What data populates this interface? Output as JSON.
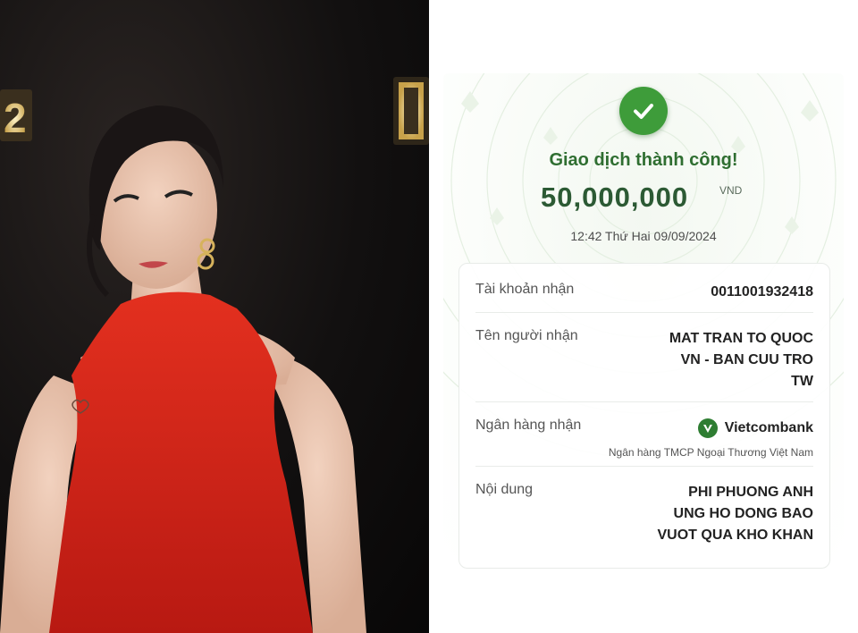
{
  "receipt": {
    "status": "Giao dịch thành công!",
    "amount": "50,000,000",
    "currency": "VND",
    "datetime": "12:42 Thứ Hai 09/09/2024",
    "account_label": "Tài khoản nhận",
    "account_value": "0011001932418",
    "recipient_label": "Tên người nhận",
    "recipient_lines": [
      "MAT TRAN TO QUOC",
      "VN - BAN CUU TRO",
      "TW"
    ],
    "bank_label": "Ngân hàng nhận",
    "bank_name": "Vietcombank",
    "bank_fullname": "Ngân hàng TMCP Ngoại Thương Việt Nam",
    "content_label": "Nội dung",
    "content_lines": [
      "PHI PHUONG ANH",
      "UNG HO DONG BAO",
      "VUOT QUA KHO KHAN"
    ]
  },
  "photo": {
    "sign_left_text": "2"
  },
  "colors": {
    "accent_green": "#3e9c3a",
    "title_green": "#2f6e31",
    "dress_red": "#d8261c"
  }
}
